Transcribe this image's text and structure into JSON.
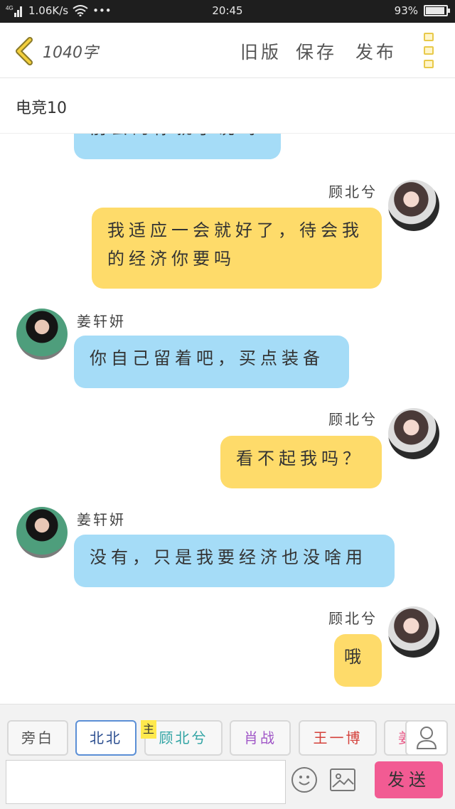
{
  "status_bar": {
    "network": "4G",
    "speed": "1.06K/s",
    "dots": "•••",
    "time": "20:45",
    "battery": "93%",
    "battery_level": 0.93
  },
  "header": {
    "word_count": "1040字",
    "old_version": "旧版",
    "save": "保存",
    "publish": "发布"
  },
  "chat": {
    "title": "电竞10"
  },
  "messages": [
    {
      "side": "left",
      "name": "",
      "text": "前去的你就了说吗",
      "color": "blue"
    },
    {
      "side": "right",
      "name": "顾北兮",
      "text": "我适应一会就好了，待会我的经济你要吗",
      "color": "yellow"
    },
    {
      "side": "left",
      "name": "姜轩妍",
      "text": "你自己留着吧，买点装备",
      "color": "blue"
    },
    {
      "side": "right",
      "name": "顾北兮",
      "text": "看不起我吗？",
      "color": "yellow"
    },
    {
      "side": "left",
      "name": "姜轩妍",
      "text": "没有，只是我要经济也没啥用",
      "color": "blue"
    },
    {
      "side": "right",
      "name": "顾北兮",
      "text": "哦",
      "color": "yellow"
    }
  ],
  "roles": [
    {
      "label": "旁白",
      "color": "#555555"
    },
    {
      "label": "北北",
      "color": "#2a4d8f"
    },
    {
      "label": "顾北兮",
      "color": "#2fa3a3",
      "tag": "主"
    },
    {
      "label": "肖战",
      "color": "#a057c7"
    },
    {
      "label": "王一博",
      "color": "#d4403a"
    },
    {
      "label": "姜",
      "color": "#e85d8a"
    }
  ],
  "composer": {
    "placeholder": "",
    "send": "发送"
  }
}
